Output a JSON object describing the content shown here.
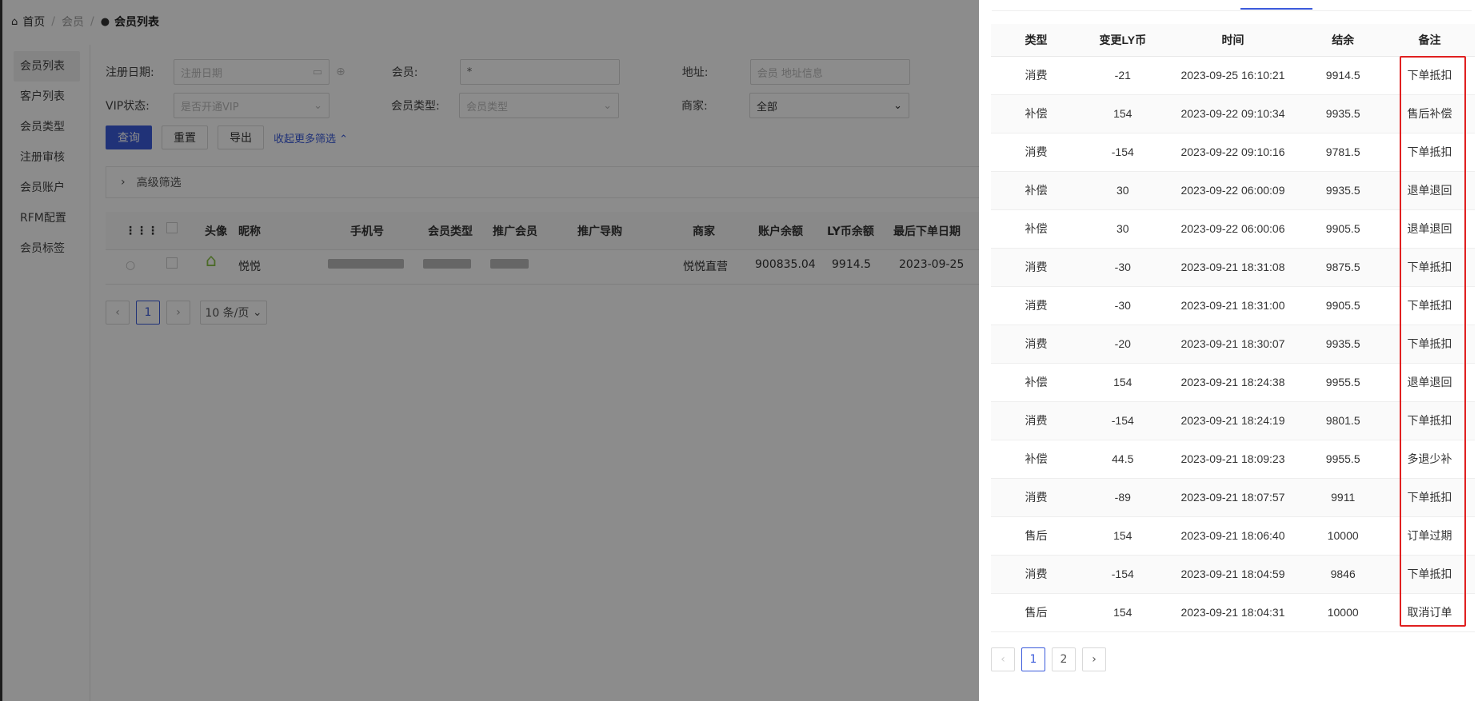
{
  "breadcrumb": {
    "home": "首页",
    "section": "会员",
    "current": "会员列表"
  },
  "sidebar": {
    "items": [
      {
        "label": "会员列表",
        "active": true
      },
      {
        "label": "客户列表"
      },
      {
        "label": "会员类型"
      },
      {
        "label": "注册审核"
      },
      {
        "label": "会员账户"
      },
      {
        "label": "RFM配置"
      },
      {
        "label": "会员标签"
      }
    ]
  },
  "filters": {
    "reg_date_label": "注册日期:",
    "reg_date_placeholder": "注册日期",
    "member_label": "会员:",
    "member_value": "*",
    "address_label": "地址:",
    "address_placeholder": "会员 地址信息",
    "vip_label": "VIP状态:",
    "vip_placeholder": "是否开通VIP",
    "member_type_label": "会员类型:",
    "member_type_placeholder": "会员类型",
    "merchant_label": "商家:",
    "merchant_value": "全部"
  },
  "actions": {
    "query": "查询",
    "reset": "重置",
    "export": "导出",
    "collapse": "收起更多筛选"
  },
  "advanced": {
    "label": "高级筛选"
  },
  "member_table": {
    "headers": [
      "头像",
      "昵称",
      "手机号",
      "会员类型",
      "推广会员",
      "推广导购",
      "商家",
      "账户余额",
      "LY币余额",
      "最后下单日期"
    ],
    "row": {
      "nickname": "悦悦",
      "merchant": "悦悦直营",
      "balance": "900835.04",
      "ly_balance": "9914.5",
      "last_order": "2023-09-25"
    }
  },
  "member_pager": {
    "page": "1",
    "size": "10 条/页"
  },
  "drawer": {
    "headers": {
      "type": "类型",
      "change": "变更LY币",
      "time": "时间",
      "balance": "结余",
      "note": "备注"
    },
    "rows": [
      {
        "type": "消费",
        "change": "-21",
        "time": "2023-09-25 16:10:21",
        "balance": "9914.5",
        "note": "下单抵扣"
      },
      {
        "type": "补偿",
        "change": "154",
        "time": "2023-09-22 09:10:34",
        "balance": "9935.5",
        "note": "售后补偿"
      },
      {
        "type": "消费",
        "change": "-154",
        "time": "2023-09-22 09:10:16",
        "balance": "9781.5",
        "note": "下单抵扣"
      },
      {
        "type": "补偿",
        "change": "30",
        "time": "2023-09-22 06:00:09",
        "balance": "9935.5",
        "note": "退单退回"
      },
      {
        "type": "补偿",
        "change": "30",
        "time": "2023-09-22 06:00:06",
        "balance": "9905.5",
        "note": "退单退回"
      },
      {
        "type": "消费",
        "change": "-30",
        "time": "2023-09-21 18:31:08",
        "balance": "9875.5",
        "note": "下单抵扣"
      },
      {
        "type": "消费",
        "change": "-30",
        "time": "2023-09-21 18:31:00",
        "balance": "9905.5",
        "note": "下单抵扣"
      },
      {
        "type": "消费",
        "change": "-20",
        "time": "2023-09-21 18:30:07",
        "balance": "9935.5",
        "note": "下单抵扣"
      },
      {
        "type": "补偿",
        "change": "154",
        "time": "2023-09-21 18:24:38",
        "balance": "9955.5",
        "note": "退单退回"
      },
      {
        "type": "消费",
        "change": "-154",
        "time": "2023-09-21 18:24:19",
        "balance": "9801.5",
        "note": "下单抵扣"
      },
      {
        "type": "补偿",
        "change": "44.5",
        "time": "2023-09-21 18:09:23",
        "balance": "9955.5",
        "note": "多退少补"
      },
      {
        "type": "消费",
        "change": "-89",
        "time": "2023-09-21 18:07:57",
        "balance": "9911",
        "note": "下单抵扣"
      },
      {
        "type": "售后",
        "change": "154",
        "time": "2023-09-21 18:06:40",
        "balance": "10000",
        "note": "订单过期"
      },
      {
        "type": "消费",
        "change": "-154",
        "time": "2023-09-21 18:04:59",
        "balance": "9846",
        "note": "下单抵扣"
      },
      {
        "type": "售后",
        "change": "154",
        "time": "2023-09-21 18:04:31",
        "balance": "10000",
        "note": "取消订单"
      }
    ],
    "pager": {
      "pages": [
        "1",
        "2"
      ],
      "current": "1"
    }
  },
  "colors": {
    "accent": "#3b5bdb",
    "highlight": "#e02020",
    "mask": "rgba(0,0,0,0.45)"
  },
  "icons": {
    "home": "home-icon",
    "user": "user-icon",
    "calendar": "calendar-icon",
    "grid": "grid-icon",
    "avatar": "house-avatar-icon"
  }
}
